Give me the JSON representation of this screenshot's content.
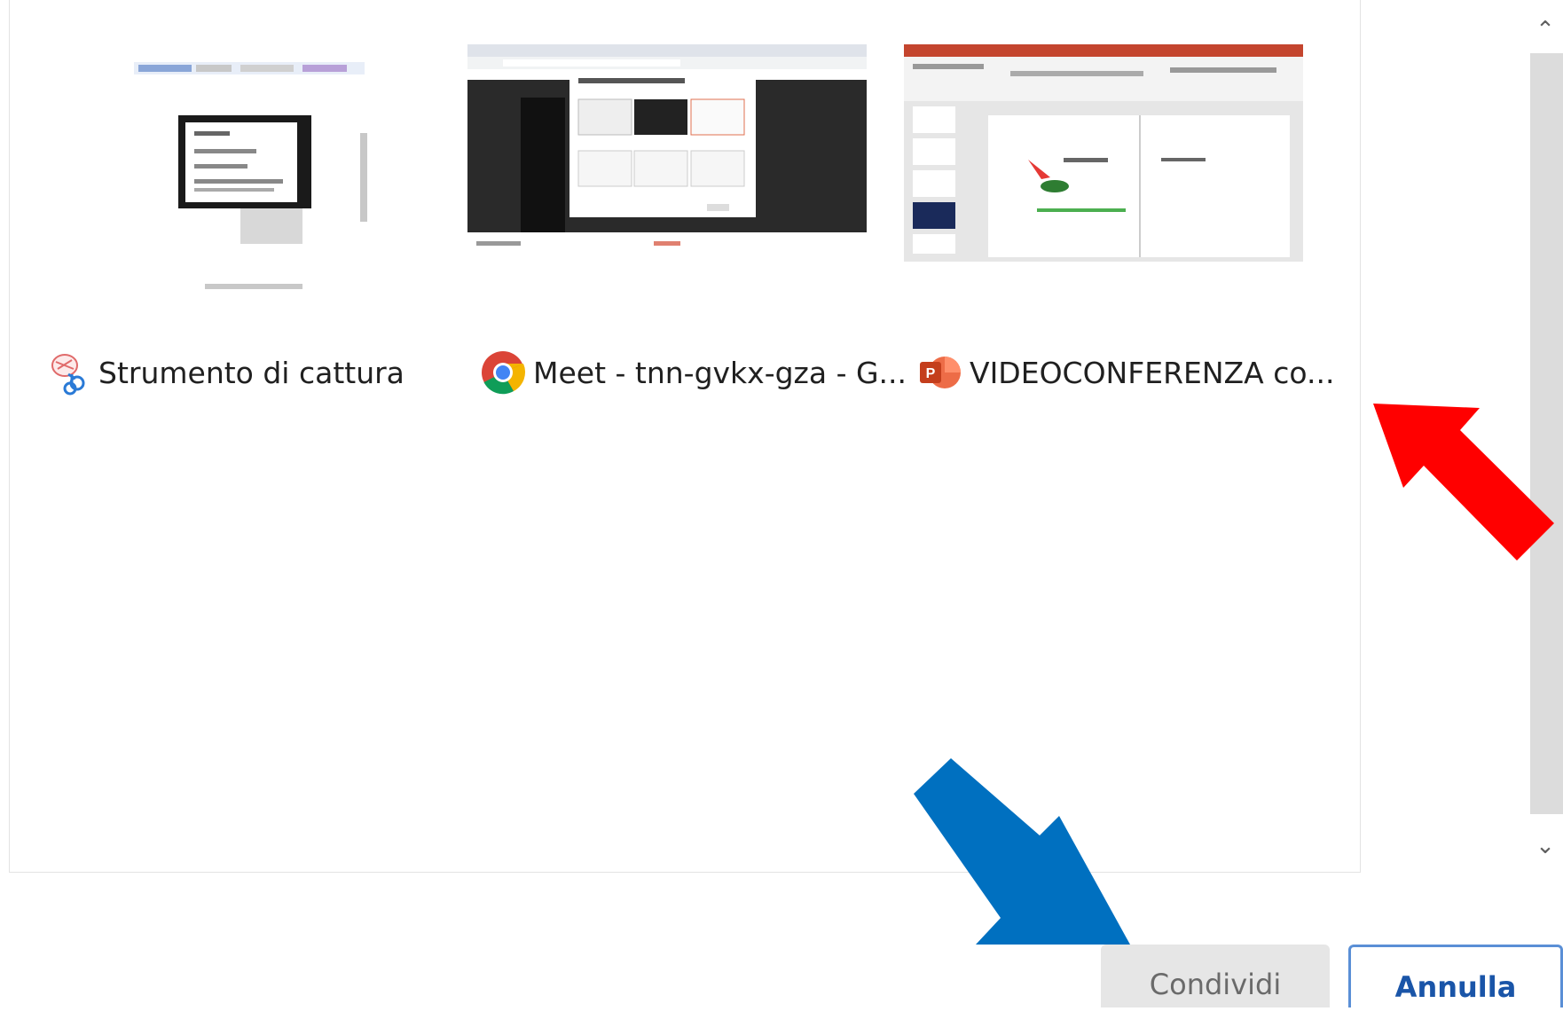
{
  "windows": [
    {
      "label": "Strumento di cattura",
      "icon": "snipping-tool-icon"
    },
    {
      "label": "Meet - tnn-gvkx-gza - G...",
      "icon": "chrome-icon"
    },
    {
      "label": "VIDEOCONFERENZA co...",
      "icon": "powerpoint-icon"
    }
  ],
  "buttons": {
    "share_label": "Condividi",
    "cancel_label": "Annulla"
  },
  "annotations": {
    "red_arrow_color": "#ff0000",
    "blue_arrow_color": "#0070c0"
  }
}
